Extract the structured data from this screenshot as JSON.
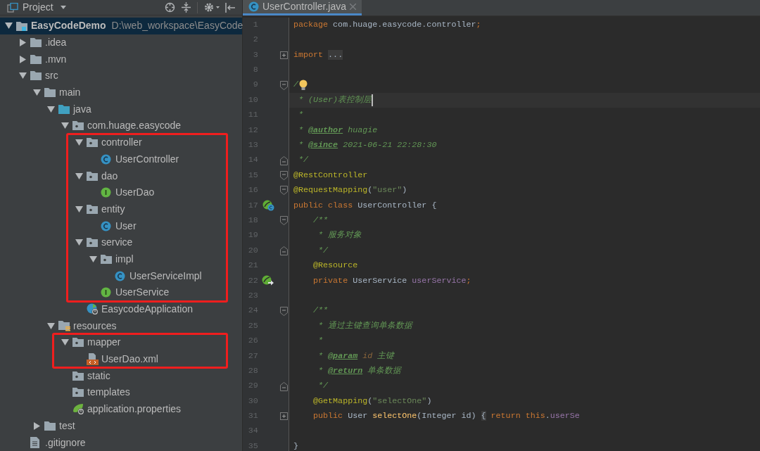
{
  "project_panel": {
    "title": "Project",
    "tree": [
      {
        "label": "EasyCodeDemo",
        "path": "D:\\web_workspace\\EasyCode",
        "kind": "module",
        "expanded": true,
        "selected": true,
        "children": [
          {
            "label": ".idea",
            "kind": "folder",
            "expanded": false,
            "selected": false
          },
          {
            "label": ".mvn",
            "kind": "folder",
            "expanded": false,
            "selected": false
          },
          {
            "label": "src",
            "kind": "folder",
            "expanded": true,
            "selected": false,
            "children": [
              {
                "label": "main",
                "kind": "folder",
                "expanded": true,
                "selected": false,
                "children": [
                  {
                    "label": "java",
                    "kind": "source-folder",
                    "expanded": true,
                    "selected": false,
                    "children": [
                      {
                        "label": "com.huage.easycode",
                        "kind": "package",
                        "expanded": true,
                        "selected": false,
                        "children": [
                          {
                            "kind": "group",
                            "highlighted": true,
                            "children": [
                              {
                                "label": "controller",
                                "kind": "package",
                                "expanded": true,
                                "selected": false,
                                "children": [
                                  {
                                    "label": "UserController",
                                    "kind": "class",
                                    "selected": false
                                  }
                                ]
                              },
                              {
                                "label": "dao",
                                "kind": "package",
                                "expanded": true,
                                "selected": false,
                                "children": [
                                  {
                                    "label": "UserDao",
                                    "kind": "interface",
                                    "selected": false
                                  }
                                ]
                              },
                              {
                                "label": "entity",
                                "kind": "package",
                                "expanded": true,
                                "selected": false,
                                "children": [
                                  {
                                    "label": "User",
                                    "kind": "class",
                                    "selected": false
                                  }
                                ]
                              },
                              {
                                "label": "service",
                                "kind": "package",
                                "expanded": true,
                                "selected": false,
                                "children": [
                                  {
                                    "label": "impl",
                                    "kind": "package",
                                    "expanded": true,
                                    "selected": false,
                                    "children": [
                                      {
                                        "label": "UserServiceImpl",
                                        "kind": "class",
                                        "selected": false
                                      }
                                    ]
                                  },
                                  {
                                    "label": "UserService",
                                    "kind": "interface",
                                    "selected": false
                                  }
                                ]
                              }
                            ]
                          },
                          {
                            "label": "EasycodeApplication",
                            "kind": "spring-app",
                            "selected": false
                          }
                        ]
                      }
                    ]
                  },
                  {
                    "label": "resources",
                    "kind": "resource-folder",
                    "expanded": true,
                    "selected": false,
                    "children": [
                      {
                        "kind": "group",
                        "highlighted": true,
                        "children": [
                          {
                            "label": "mapper",
                            "kind": "package",
                            "expanded": true,
                            "selected": false,
                            "children": [
                              {
                                "label": "UserDao.xml",
                                "kind": "xml",
                                "selected": false
                              }
                            ]
                          }
                        ]
                      },
                      {
                        "label": "static",
                        "kind": "package",
                        "selected": false
                      },
                      {
                        "label": "templates",
                        "kind": "package",
                        "selected": false
                      },
                      {
                        "label": "application.properties",
                        "kind": "properties",
                        "selected": false
                      }
                    ]
                  }
                ]
              },
              {
                "label": "test",
                "kind": "folder",
                "expanded": false,
                "selected": false
              }
            ]
          },
          {
            "label": ".gitignore",
            "kind": "file",
            "selected": false
          }
        ]
      }
    ]
  },
  "editor": {
    "tabs": [
      {
        "label": "UserController.java",
        "selected": true
      }
    ],
    "lines": [
      {
        "number": "1",
        "segments": [
          {
            "kind": "keyword",
            "text": "package "
          },
          {
            "kind": "plain",
            "text": "com.huage.easycode.controller"
          },
          {
            "kind": "keyword",
            "text": ";"
          }
        ]
      },
      {
        "number": "2"
      },
      {
        "number": "3",
        "fold": {
          "kind": "plus"
        },
        "segments": [
          {
            "kind": "keyword",
            "text": "import "
          },
          {
            "kind": "folded",
            "text": "..."
          }
        ]
      },
      {
        "number": "8"
      },
      {
        "number": "9",
        "fold": {
          "kind": "open"
        },
        "bulb": true,
        "segments": [
          {
            "kind": "comment",
            "text": "/"
          }
        ]
      },
      {
        "number": "10",
        "current": true,
        "segments": [
          {
            "kind": "comment",
            "text": " * (User)表控制层"
          }
        ]
      },
      {
        "number": "11",
        "segments": [
          {
            "kind": "comment",
            "text": " *"
          }
        ]
      },
      {
        "number": "12",
        "segments": [
          {
            "kind": "comment",
            "text": " * "
          },
          {
            "kind": "doctag",
            "text": "@author"
          },
          {
            "kind": "comment",
            "text": " huagie"
          }
        ]
      },
      {
        "number": "13",
        "segments": [
          {
            "kind": "comment",
            "text": " * "
          },
          {
            "kind": "doctag",
            "text": "@since"
          },
          {
            "kind": "comment",
            "text": " 2021-06-21 22:28:30"
          }
        ]
      },
      {
        "number": "14",
        "fold": {
          "kind": "close"
        },
        "segments": [
          {
            "kind": "comment",
            "text": " */"
          }
        ]
      },
      {
        "number": "15",
        "fold": {
          "kind": "open"
        },
        "segments": [
          {
            "kind": "annotation",
            "text": "@RestController"
          }
        ]
      },
      {
        "number": "16",
        "fold": {
          "kind": "open"
        },
        "segments": [
          {
            "kind": "annotation",
            "text": "@RequestMapping"
          },
          {
            "kind": "plain",
            "text": "("
          },
          {
            "kind": "string",
            "text": "\"user\""
          },
          {
            "kind": "plain",
            "text": ")"
          }
        ]
      },
      {
        "number": "17",
        "gutter": {
          "kind": "bean-class"
        },
        "segments": [
          {
            "kind": "keyword",
            "text": "public class "
          },
          {
            "kind": "plain",
            "text": "UserController {"
          }
        ]
      },
      {
        "number": "18",
        "fold": {
          "kind": "open"
        },
        "segments": [
          {
            "kind": "comment",
            "text": "    /**"
          }
        ]
      },
      {
        "number": "19",
        "segments": [
          {
            "kind": "comment",
            "text": "     * 服务对象"
          }
        ]
      },
      {
        "number": "20",
        "fold": {
          "kind": "close"
        },
        "segments": [
          {
            "kind": "comment",
            "text": "     */"
          }
        ]
      },
      {
        "number": "21",
        "segments": [
          {
            "kind": "annotation",
            "text": "    @Resource"
          }
        ]
      },
      {
        "number": "22",
        "gutter": {
          "kind": "bean-inject"
        },
        "segments": [
          {
            "kind": "keyword",
            "text": "    private "
          },
          {
            "kind": "plain",
            "text": "UserService "
          },
          {
            "kind": "field",
            "text": "userService"
          },
          {
            "kind": "keyword",
            "text": ";"
          }
        ]
      },
      {
        "number": "23"
      },
      {
        "number": "24",
        "fold": {
          "kind": "open"
        },
        "segments": [
          {
            "kind": "comment",
            "text": "    /**"
          }
        ]
      },
      {
        "number": "25",
        "segments": [
          {
            "kind": "comment",
            "text": "     * 通过主键查询单条数据"
          }
        ]
      },
      {
        "number": "26",
        "segments": [
          {
            "kind": "comment",
            "text": "     *"
          }
        ]
      },
      {
        "number": "27",
        "segments": [
          {
            "kind": "comment",
            "text": "     * "
          },
          {
            "kind": "doctag",
            "text": "@param"
          },
          {
            "kind": "param",
            "text": " id"
          },
          {
            "kind": "comment",
            "text": " 主键"
          }
        ]
      },
      {
        "number": "28",
        "segments": [
          {
            "kind": "comment",
            "text": "     * "
          },
          {
            "kind": "doctag",
            "text": "@return"
          },
          {
            "kind": "comment",
            "text": " 单条数据"
          }
        ]
      },
      {
        "number": "29",
        "fold": {
          "kind": "close"
        },
        "segments": [
          {
            "kind": "comment",
            "text": "     */"
          }
        ]
      },
      {
        "number": "30",
        "segments": [
          {
            "kind": "annotation",
            "text": "    @GetMapping"
          },
          {
            "kind": "plain",
            "text": "("
          },
          {
            "kind": "string",
            "text": "\"selectOne\""
          },
          {
            "kind": "plain",
            "text": ")"
          }
        ]
      },
      {
        "number": "31",
        "fold": {
          "kind": "plus"
        },
        "segments": [
          {
            "kind": "keyword",
            "text": "    public "
          },
          {
            "kind": "plain",
            "text": "User "
          },
          {
            "kind": "method",
            "text": "selectOne"
          },
          {
            "kind": "plain",
            "text": "(Integer id) "
          },
          {
            "kind": "folded",
            "text": "{"
          },
          {
            "kind": "keyword",
            "text": " return this"
          },
          {
            "kind": "plain",
            "text": "."
          },
          {
            "kind": "field",
            "text": "userSe"
          }
        ]
      },
      {
        "number": "34"
      },
      {
        "number": "35",
        "segments": [
          {
            "kind": "plain",
            "text": "}"
          }
        ]
      }
    ]
  }
}
